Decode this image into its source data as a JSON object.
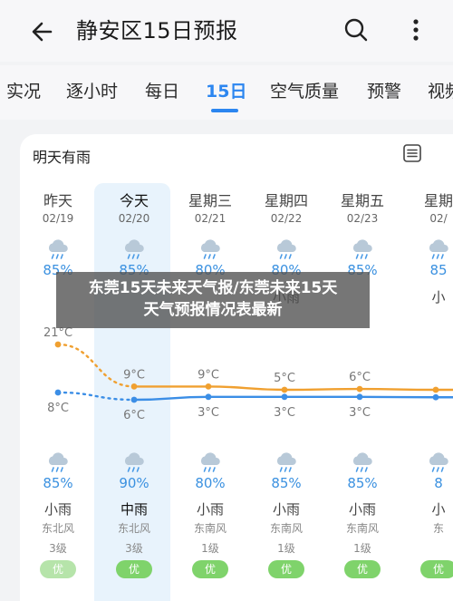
{
  "header": {
    "title": "静安区15日预报"
  },
  "tabs": [
    "实况",
    "逐小时",
    "每日",
    "15日",
    "空气质量",
    "预警",
    "视频"
  ],
  "active_tab": "15日",
  "card": {
    "title": "明天有雨",
    "days": [
      {
        "day": "昨天",
        "date": "02/19",
        "day_precip": "85%",
        "day_weather": "",
        "high": "21°C",
        "low": "8°C",
        "night_precip": "85%",
        "night_weather": "小雨",
        "wind": "东北风",
        "wind_level": "3级",
        "aqi": "优"
      },
      {
        "day": "今天",
        "date": "02/20",
        "day_precip": "85%",
        "day_weather": "",
        "high": "9°C",
        "low": "6°C",
        "night_precip": "90%",
        "night_weather": "中雨",
        "wind": "东北风",
        "wind_level": "3级",
        "aqi": "优"
      },
      {
        "day": "星期三",
        "date": "02/21",
        "day_precip": "80%",
        "day_weather": "",
        "high": "9°C",
        "low": "3°C",
        "night_precip": "80%",
        "night_weather": "小雨",
        "wind": "东南风",
        "wind_level": "1级",
        "aqi": "优"
      },
      {
        "day": "星期四",
        "date": "02/22",
        "day_precip": "80%",
        "day_weather": "小雨",
        "high": "5°C",
        "low": "3°C",
        "night_precip": "85%",
        "night_weather": "小雨",
        "wind": "东南风",
        "wind_level": "1级",
        "aqi": "优"
      },
      {
        "day": "星期五",
        "date": "02/23",
        "day_precip": "85%",
        "day_weather": "",
        "high": "6°C",
        "low": "3°C",
        "night_precip": "85%",
        "night_weather": "小雨",
        "wind": "东南风",
        "wind_level": "1级",
        "aqi": "优"
      },
      {
        "day": "星期",
        "date": "02/",
        "day_precip": "85",
        "day_weather": "小",
        "high": "",
        "low": "",
        "night_precip": "8",
        "night_weather": "小",
        "wind": "东",
        "wind_level": "",
        "aqi": "优"
      }
    ]
  },
  "temperature_chart": {
    "high": [
      21,
      9,
      9,
      5,
      6,
      5
    ],
    "low": [
      8,
      6,
      3,
      3,
      3,
      2.5
    ],
    "high_color": "#f0a030",
    "low_color": "#3b8ee6"
  },
  "overlay": {
    "line1": "东莞15天未来天气报/东莞未来15天",
    "line2": "天气预报情况表最新"
  },
  "colors": {
    "accent": "#2c86f0",
    "aqi_good": "#7fd36b",
    "precip": "#3b91e0"
  }
}
